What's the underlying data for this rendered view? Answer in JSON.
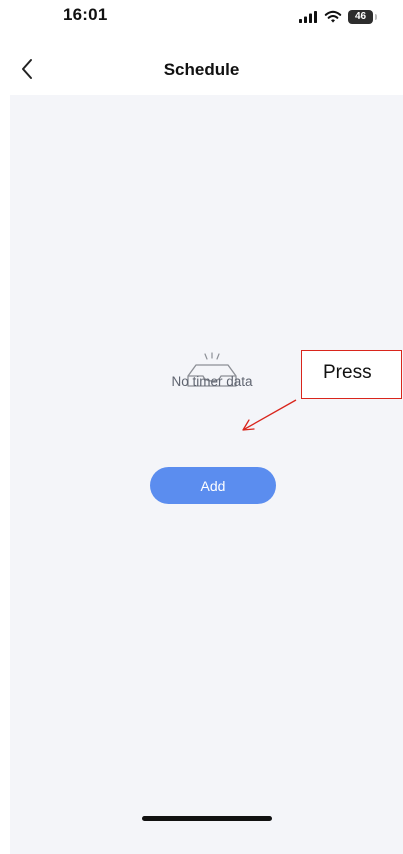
{
  "status_bar": {
    "time": "16:01",
    "signal_icon": "cellular-signal-icon",
    "wifi_icon": "wifi-icon",
    "battery_level": "46"
  },
  "nav": {
    "back_icon": "chevron-left-icon",
    "title": "Schedule"
  },
  "empty_state": {
    "icon": "empty-inbox-icon",
    "text": "No timer data"
  },
  "add_button": {
    "label": "Add",
    "color": "#5b8def"
  },
  "annotation": {
    "text": "Press",
    "color": "#d9251c"
  },
  "colors": {
    "background": "#f4f5f9",
    "text_muted": "#5f6470"
  }
}
